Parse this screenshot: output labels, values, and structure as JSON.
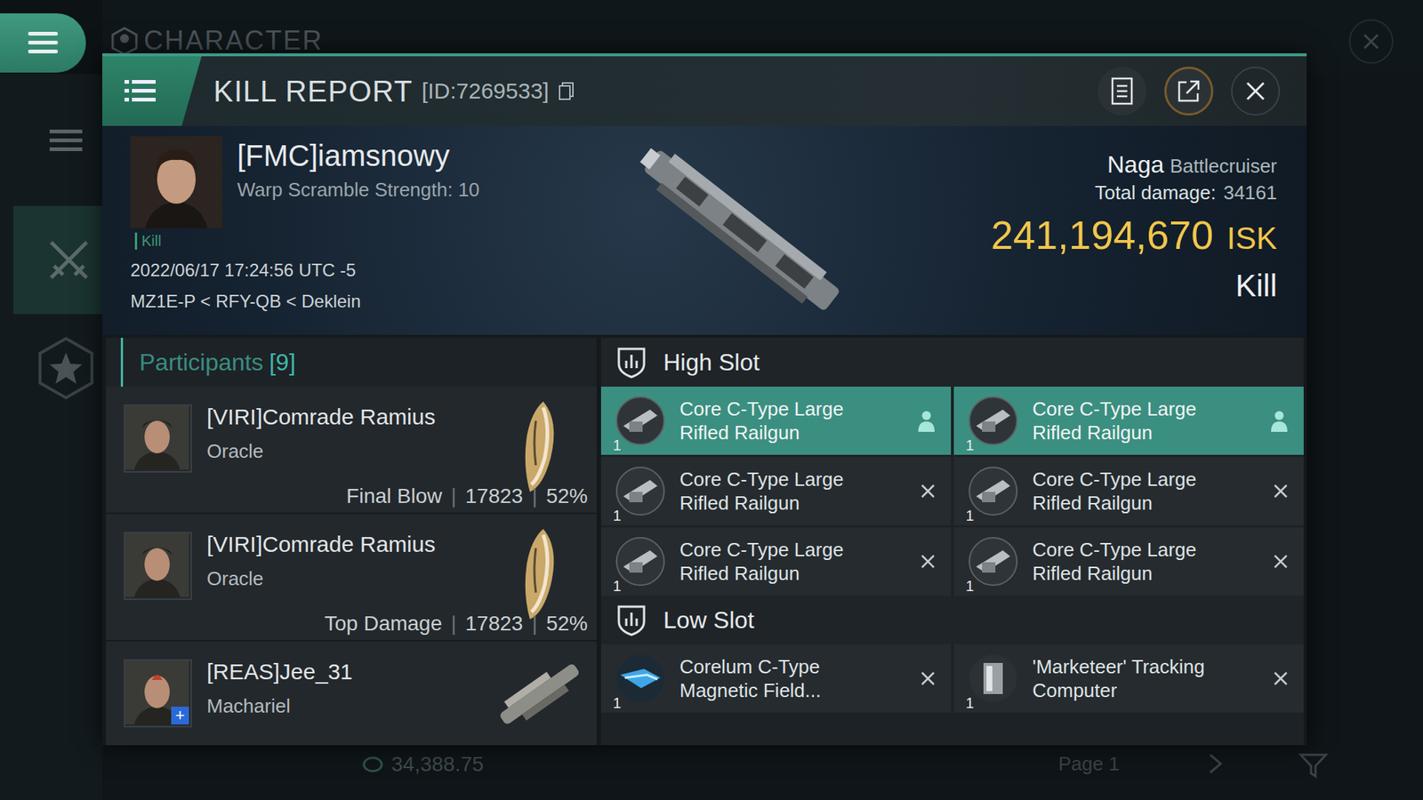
{
  "background": {
    "title": "CHARACTER",
    "footer_value": "34,388.75",
    "page": "Page 1"
  },
  "report": {
    "title": "KILL REPORT",
    "id": "[ID:7269533]"
  },
  "victim": {
    "name": "[FMC]iamsnowy",
    "detail": "Warp Scramble Strength: 10",
    "tag": "Kill",
    "time": "2022/06/17 17:24:56 UTC -5",
    "location": "MZ1E-P < RFY-QB < Deklein",
    "ship": "Naga",
    "ship_class": "Battlecruiser",
    "damage_label": "Total damage:",
    "damage": "34161",
    "value": "241,194,670",
    "currency": "ISK",
    "result": "Kill"
  },
  "participants": {
    "label": "Participants",
    "count": "[9]",
    "separator": "|",
    "items": [
      {
        "name": "[VIRI]Comrade Ramius",
        "ship": "Oracle",
        "kind": "gold-hull",
        "role": "Final Blow",
        "damage": "17823",
        "share": "52%",
        "badge": ""
      },
      {
        "name": "[VIRI]Comrade Ramius",
        "ship": "Oracle",
        "kind": "gold-hull",
        "role": "Top Damage",
        "damage": "17823",
        "share": "52%",
        "badge": ""
      },
      {
        "name": "[REAS]Jee_31",
        "ship": "Machariel",
        "kind": "grey-hull",
        "role": "",
        "damage": "",
        "share": "",
        "badge": "+"
      }
    ]
  },
  "slots": [
    {
      "label": "High Slot",
      "items": [
        {
          "qty": "1",
          "name": "Core C-Type Large Rifled Railgun",
          "kind": "weapon",
          "dropped": true
        },
        {
          "qty": "1",
          "name": "Core C-Type Large Rifled Railgun",
          "kind": "weapon",
          "dropped": true
        },
        {
          "qty": "1",
          "name": "Core C-Type Large Rifled Railgun",
          "kind": "weapon",
          "dropped": false
        },
        {
          "qty": "1",
          "name": "Core C-Type Large Rifled Railgun",
          "kind": "weapon",
          "dropped": false
        },
        {
          "qty": "1",
          "name": "Core C-Type Large Rifled Railgun",
          "kind": "weapon",
          "dropped": false
        },
        {
          "qty": "1",
          "name": "Core C-Type Large Rifled Railgun",
          "kind": "weapon",
          "dropped": false
        }
      ]
    },
    {
      "label": "Low Slot",
      "items": [
        {
          "qty": "1",
          "name": "Corelum C-Type Magnetic Field...",
          "kind": "field",
          "dropped": false
        },
        {
          "qty": "1",
          "name": "'Marketeer' Tracking Computer",
          "kind": "tracking",
          "dropped": false
        }
      ]
    }
  ]
}
